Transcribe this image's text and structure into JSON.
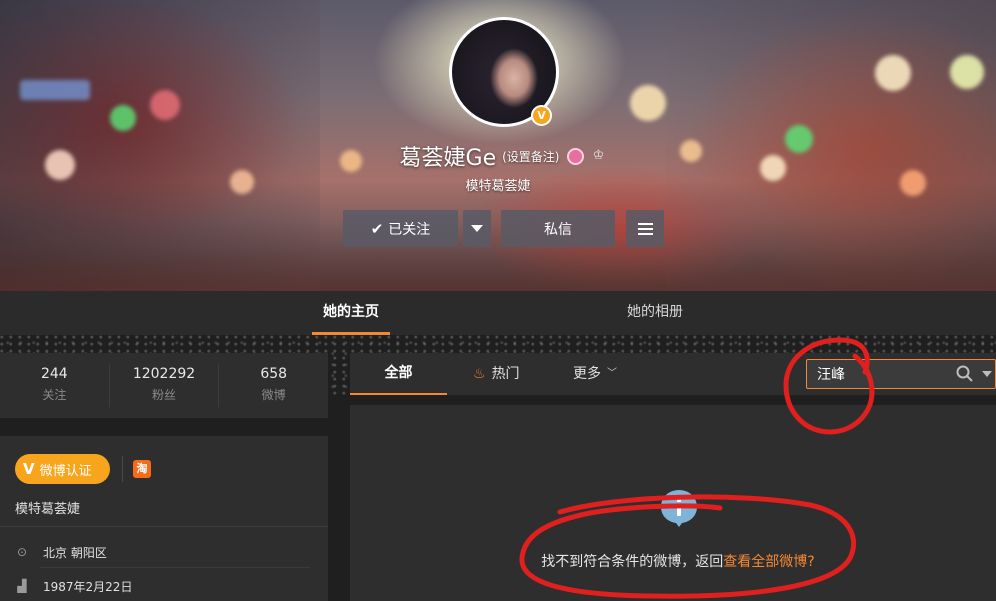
{
  "profile": {
    "name": "葛荟婕Ge",
    "remark": "(设置备注)",
    "title": "模特葛荟婕",
    "verified_mark": "V"
  },
  "actions": {
    "follow_label": "已关注",
    "message_label": "私信"
  },
  "nav_tabs": [
    {
      "label": "她的主页",
      "active": true
    },
    {
      "label": "她的相册",
      "active": false
    }
  ],
  "stats": [
    {
      "value": "244",
      "label": "关注"
    },
    {
      "value": "1202292",
      "label": "粉丝"
    },
    {
      "value": "658",
      "label": "微博"
    }
  ],
  "profile_card": {
    "verify_label": "微博认证",
    "verify_mark": "V",
    "taobao_mark": "淘",
    "bio": "模特葛荟婕",
    "location": "北京 朝阳区",
    "birthday": "1987年2月22日"
  },
  "feed_tabs": [
    {
      "label": "全部",
      "active": true
    },
    {
      "label": "热门",
      "icon": "flame-icon"
    },
    {
      "label": "更多",
      "icon": "chevron-down-icon"
    }
  ],
  "search": {
    "value": "汪峰"
  },
  "empty_state": {
    "message": "找不到符合条件的微博，返回",
    "link": "查看全部微博?"
  },
  "colors": {
    "accent": "#f58833",
    "verified": "#f7a51c",
    "panel": "#2e2e2e",
    "annotation": "#e0201e"
  }
}
